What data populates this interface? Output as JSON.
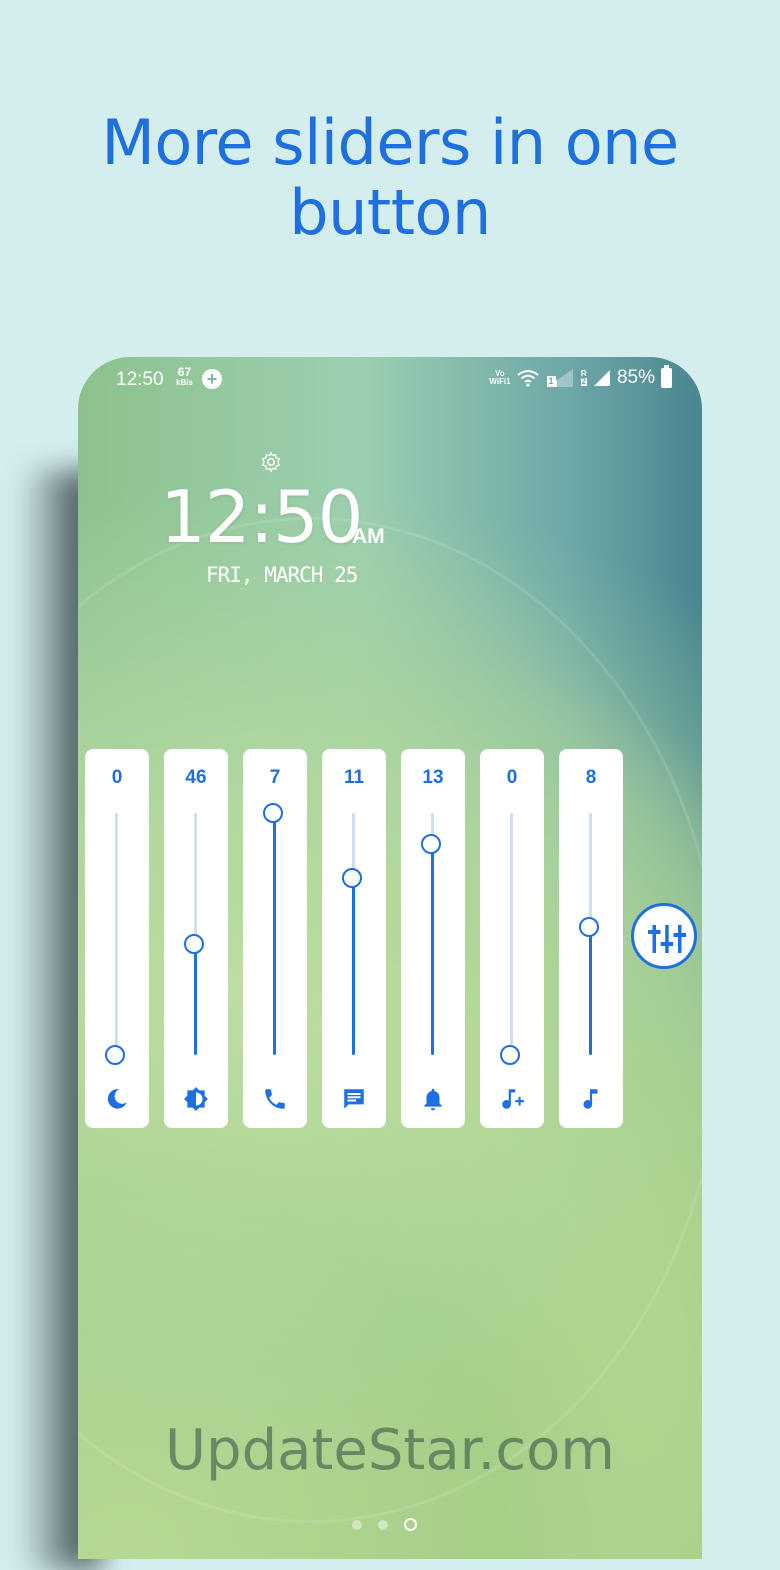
{
  "headline": {
    "line1": "More sliders in one",
    "line2": "button"
  },
  "status_bar": {
    "time": "12:50",
    "speed_value": "67",
    "speed_unit": "kB/s",
    "vowifi_top": "Vo",
    "vowifi_bottom": "WiFi1",
    "sim1_label": "1",
    "sim2_top": "R",
    "sim2_bottom": "2",
    "battery": "85%"
  },
  "lockscreen": {
    "time": "12:50",
    "ampm": "AM",
    "date": "FRI, MARCH 25"
  },
  "sliders": [
    {
      "value": "0",
      "level": 0.0,
      "icon": "night-mode-icon"
    },
    {
      "value": "46",
      "level": 0.46,
      "icon": "brightness-icon"
    },
    {
      "value": "7",
      "level": 1.0,
      "icon": "call-icon"
    },
    {
      "value": "11",
      "level": 0.73,
      "icon": "message-icon"
    },
    {
      "value": "13",
      "level": 0.87,
      "icon": "ringtone-bell-icon"
    },
    {
      "value": "0",
      "level": 0.0,
      "icon": "media-add-icon"
    },
    {
      "value": "8",
      "level": 0.53,
      "icon": "music-icon"
    }
  ],
  "colors": {
    "accent": "#1e6fe0",
    "track": "#cfdcf2",
    "background": "#d4eeee"
  },
  "watermark": "UpdateStar.com",
  "pager": {
    "count": 3,
    "active": 2
  }
}
